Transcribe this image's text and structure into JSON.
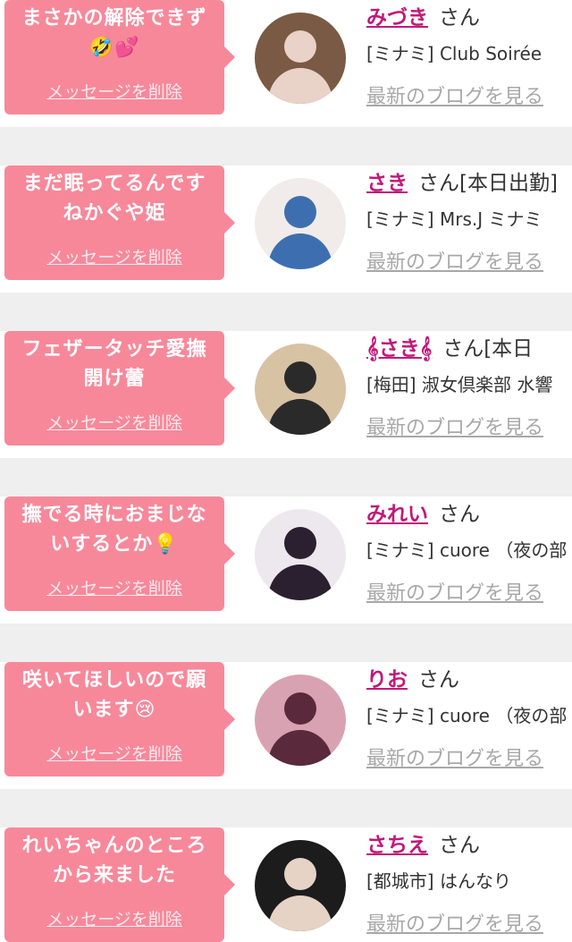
{
  "messages": [
    {
      "message_text": "まさかの解除できず🤣💕",
      "delete_label": "メッセージを削除",
      "girl_name": "みづき",
      "suffix": "さん",
      "shop": "[ミナミ] Club Soirée",
      "blog_label": "最新のブログを見る",
      "avatar_bg": "#7a5a44",
      "avatar_fg": "#e9d2c8"
    },
    {
      "message_text": "まだ眠ってるんです ねかぐや姫",
      "delete_label": "メッセージを削除",
      "girl_name": "さき",
      "suffix": "さん[本日出勤]",
      "shop": "[ミナミ] Mrs.J ミナミ",
      "blog_label": "最新のブログを見る",
      "avatar_bg": "#f1ece9",
      "avatar_fg": "#3d6fb0"
    },
    {
      "message_text": "フェザータッチ愛撫 開け蕾",
      "delete_label": "メッセージを削除",
      "girl_name": "𝄞さき𝄞",
      "suffix": "さん[本日",
      "shop": "[梅田] 淑女倶楽部 水響",
      "blog_label": "最新のブログを見る",
      "avatar_bg": "#d8c2a4",
      "avatar_fg": "#2a2a2a"
    },
    {
      "message_text": "撫でる時におまじな いするとか💡",
      "delete_label": "メッセージを削除",
      "girl_name": "みれい",
      "suffix": "さん",
      "shop": "[ミナミ] cuore （夜の部",
      "blog_label": "最新のブログを見る",
      "avatar_bg": "#ede8ee",
      "avatar_fg": "#2b2030"
    },
    {
      "message_text": "咲いてほしいので願 います😢",
      "delete_label": "メッセージを削除",
      "girl_name": "りお",
      "suffix": "さん",
      "shop": "[ミナミ] cuore （夜の部",
      "blog_label": "最新のブログを見る",
      "avatar_bg": "#d9a2b2",
      "avatar_fg": "#5a2a3c"
    },
    {
      "message_text": "れいちゃんのところ から来ました",
      "delete_label": "メッセージを削除",
      "girl_name": "さちえ",
      "suffix": "さん",
      "shop": "[都城市] はんなり",
      "blog_label": "最新のブログを見る",
      "avatar_bg": "#1c1c1c",
      "avatar_fg": "#e6d3c6"
    }
  ]
}
